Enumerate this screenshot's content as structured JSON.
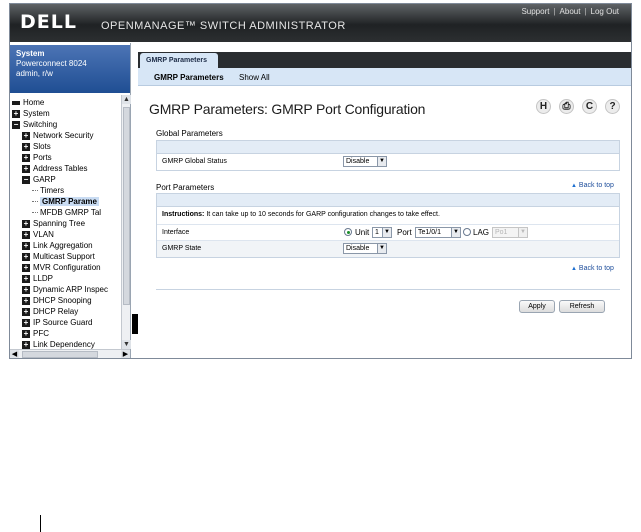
{
  "header": {
    "logo": "DELL",
    "app_title": "OPENMANAGE™ SWITCH ADMINISTRATOR",
    "links": [
      "Support",
      "About",
      "Log Out"
    ]
  },
  "system": {
    "title": "System",
    "model": "Powerconnect 8024",
    "user": "admin, r/w"
  },
  "tree": [
    {
      "label": "Home",
      "level": 0,
      "marker": "home"
    },
    {
      "label": "System",
      "level": 0,
      "marker": "plus"
    },
    {
      "label": "Switching",
      "level": 0,
      "marker": "minus"
    },
    {
      "label": "Network Security",
      "level": 1,
      "marker": "plus"
    },
    {
      "label": "Slots",
      "level": 1,
      "marker": "plus"
    },
    {
      "label": "Ports",
      "level": 1,
      "marker": "plus"
    },
    {
      "label": "Address Tables",
      "level": 1,
      "marker": "plus"
    },
    {
      "label": "GARP",
      "level": 1,
      "marker": "minus"
    },
    {
      "label": "Timers",
      "level": 2,
      "marker": "line"
    },
    {
      "label": "GMRP Parame",
      "level": 2,
      "marker": "line",
      "selected": true
    },
    {
      "label": "MFDB GMRP Tal",
      "level": 2,
      "marker": "line"
    },
    {
      "label": "Spanning Tree",
      "level": 1,
      "marker": "plus"
    },
    {
      "label": "VLAN",
      "level": 1,
      "marker": "plus"
    },
    {
      "label": "Link Aggregation",
      "level": 1,
      "marker": "plus"
    },
    {
      "label": "Multicast Support",
      "level": 1,
      "marker": "plus"
    },
    {
      "label": "MVR Configuration",
      "level": 1,
      "marker": "plus"
    },
    {
      "label": "LLDP",
      "level": 1,
      "marker": "plus"
    },
    {
      "label": "Dynamic ARP Inspec",
      "level": 1,
      "marker": "plus"
    },
    {
      "label": "DHCP Snooping",
      "level": 1,
      "marker": "plus"
    },
    {
      "label": "DHCP Relay",
      "level": 1,
      "marker": "plus"
    },
    {
      "label": "IP Source Guard",
      "level": 1,
      "marker": "plus"
    },
    {
      "label": "PFC",
      "level": 1,
      "marker": "plus"
    },
    {
      "label": "Link Dependency",
      "level": 1,
      "marker": "plus"
    }
  ],
  "tabs": {
    "active": "GMRP Parameters",
    "sub": [
      "GMRP Parameters",
      "Show All"
    ]
  },
  "page": {
    "title": "GMRP Parameters: GMRP Port Configuration",
    "icons": [
      "save-icon",
      "print-icon",
      "refresh-icon",
      "help-icon"
    ],
    "icon_glyphs": [
      "H",
      "⎙",
      "C",
      "?"
    ]
  },
  "global": {
    "section": "Global Parameters",
    "status_label": "GMRP Global Status",
    "status_value": "Disable"
  },
  "port": {
    "section": "Port Parameters",
    "back_to_top": "Back to top",
    "instructions_bold": "Instructions:",
    "instructions_text": " It can take up to 10 seconds for GARP configuration changes to take effect.",
    "interface_label": "Interface",
    "unit_label": "Unit",
    "unit_value": "1",
    "port_label": "Port",
    "port_value": "Te1/0/1",
    "lag_label": "LAG",
    "lag_value": "Po1",
    "state_label": "GMRP State",
    "state_value": "Disable"
  },
  "buttons": {
    "apply": "Apply",
    "refresh": "Refresh"
  }
}
